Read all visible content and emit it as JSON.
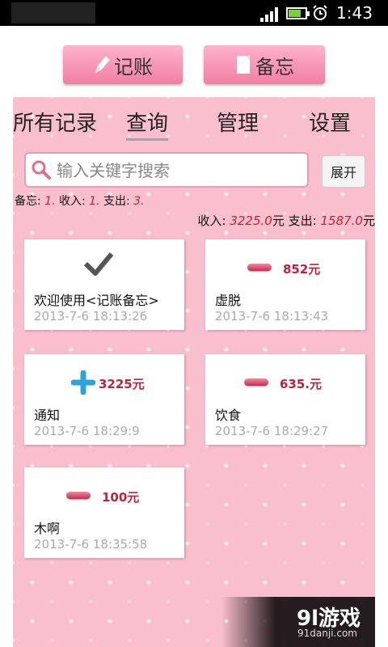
{
  "status_bar": {
    "time": "1:43"
  },
  "toolbar": {
    "bookkeeping_label": "记账",
    "memo_label": "备忘"
  },
  "tabs": [
    {
      "label": "所有记录"
    },
    {
      "label": "查询",
      "selected": true
    },
    {
      "label": "管理"
    },
    {
      "label": "设置"
    }
  ],
  "search": {
    "placeholder": "输入关键字搜索",
    "expand_label": "展开"
  },
  "summary": {
    "memo_label": "备忘:",
    "memo_count": "1.",
    "income_label": "收入:",
    "income_count": "1.",
    "expense_label": "支出:",
    "expense_count": "3."
  },
  "totals": {
    "income_label": "收入:",
    "income_value": "3225.0",
    "income_unit": "元",
    "expense_label": "支出:",
    "expense_value": "1587.0",
    "expense_unit": "元"
  },
  "records": [
    {
      "type": "memo",
      "title": "欢迎使用<记账备忘>",
      "time": "2013-7-6 18:13:26"
    },
    {
      "type": "expense",
      "amount": "852元",
      "title": "虚脱",
      "time": "2013-7-6 18:13:43"
    },
    {
      "type": "income",
      "amount": "3225元",
      "title": "通知",
      "time": "2013-7-6 18:29:9"
    },
    {
      "type": "expense",
      "amount": "635.元",
      "title": "饮食",
      "time": "2013-7-6 18:29:27"
    },
    {
      "type": "expense",
      "amount": "100元",
      "title": "木啊",
      "time": "2013-7-6 18:35:58"
    }
  ],
  "watermark": {
    "logo": "9l游戏",
    "url": "91danji.com"
  },
  "colors": {
    "accent_red": "#c0223b",
    "panel_pink": "#f9bfcd",
    "button_pink": "#f27ea4"
  }
}
